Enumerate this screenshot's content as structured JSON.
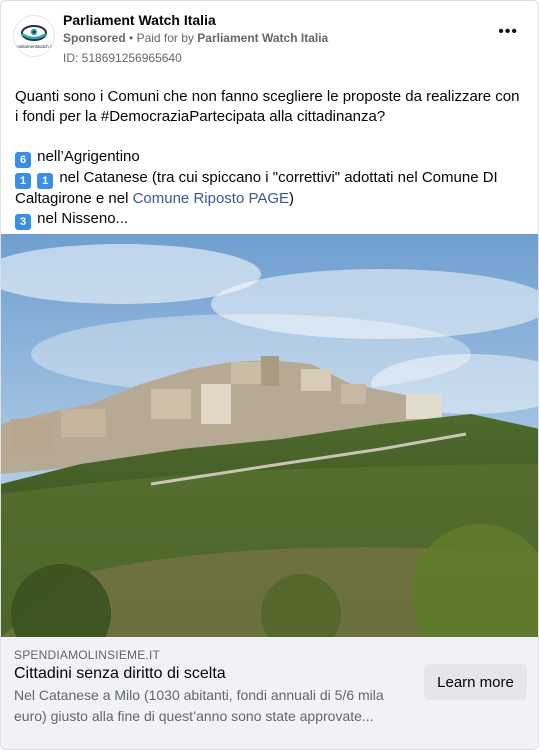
{
  "ad": {
    "page_name": "Parliament Watch Italia",
    "sponsored_label": "Sponsored",
    "paid_for_prefix": "Paid for by",
    "paid_for_name": "Parliament Watch Italia",
    "id_label": "ID: 518691256965640",
    "more_icon": "more-horizontal-icon",
    "logo_text": "parliamentwatch.it"
  },
  "body": {
    "intro": "Quanti sono i Comuni che non fanno scegliere le proposte da realizzare con i fondi per la #DemocraziaPartecipata alla cittadinanza?",
    "line1_num": "6",
    "line1_text": "nell’Agrigentino",
    "line2_num_a": "1",
    "line2_num_b": "1",
    "line2_text": "nel Catanese (tra cui spiccano i \"correttivi\" adottati nel Comune DI Caltagirone e nel ",
    "line2_link": "Comune Riposto PAGE",
    "line2_end": ")",
    "line3_num": "3",
    "line3_text": "nel Nisseno..."
  },
  "link_preview": {
    "domain": "SPENDIAMOLINSIEME.IT",
    "headline": "Cittadini senza diritto di scelta",
    "description": "Nel Catanese a Milo (1030 abitanti, fondi annuali di 5/6 mila euro) giusto alla fine di quest’anno sono state approvate...",
    "cta_label": "Learn more"
  },
  "colors": {
    "link": "#385898",
    "keycap": "#3a8ee6",
    "footer_bg": "#f0f2f5",
    "button_bg": "#e4e6eb"
  }
}
